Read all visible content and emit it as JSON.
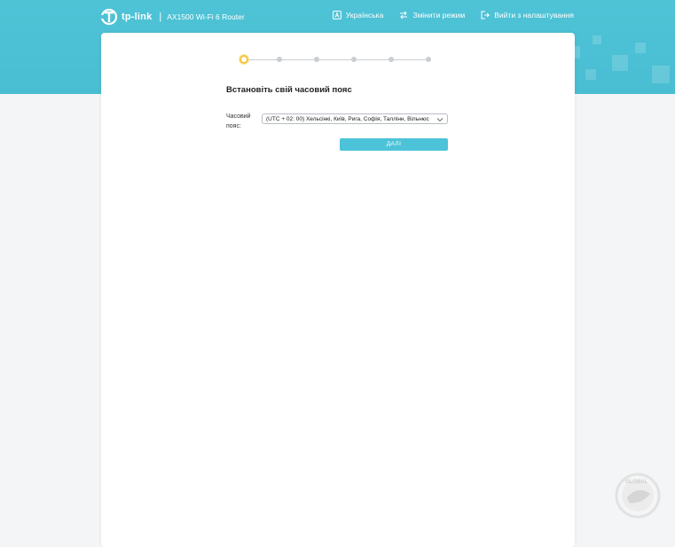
{
  "header": {
    "brand": "tp-link",
    "model": "AX1500 Wi-Fi 6 Router",
    "language_label": "Українська",
    "change_mode_label": "Змінити режим",
    "logout_label": "Вийти з налаштування"
  },
  "wizard": {
    "steps_total": 6,
    "current_step": 1,
    "title": "Встановіть свій часовий пояс",
    "timezone_label": "Часовий пояс:",
    "timezone_value": "(UTC + 02: 00) Хельсінкі, Київ, Рига, Софія, Таллінн, Вільнюс",
    "next_label": "ДАЛІ"
  },
  "colors": {
    "accent": "#4cc3d8",
    "active_step": "#f5c43a"
  },
  "watermark": {
    "text": "GLOBAL"
  }
}
